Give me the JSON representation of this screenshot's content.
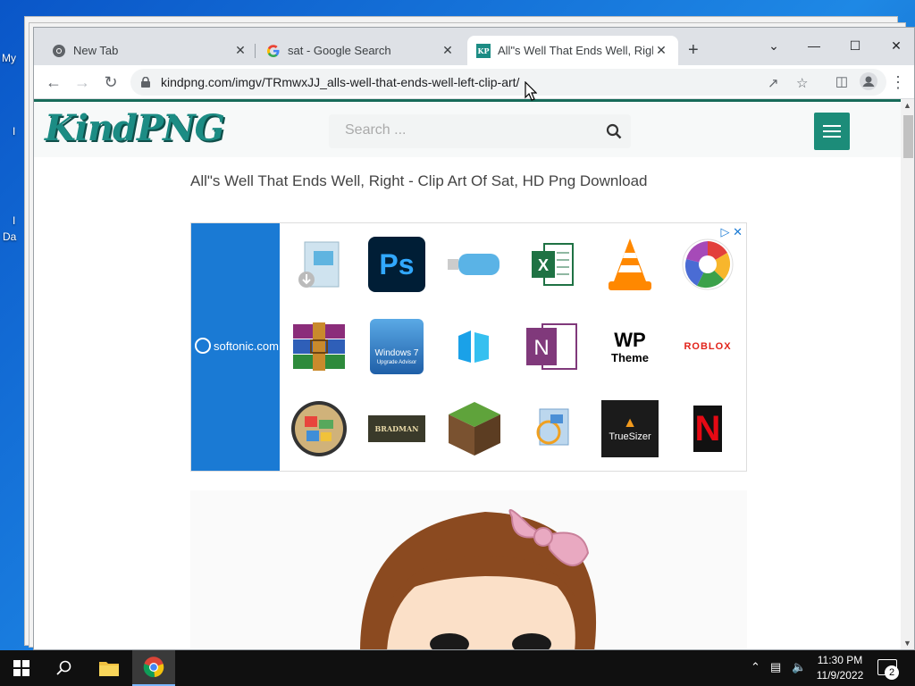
{
  "desktop": {
    "icon_labels": [
      "My",
      "I",
      "Da"
    ]
  },
  "browser": {
    "tabs": [
      {
        "title": "New Tab",
        "favicon": "chrome-icon"
      },
      {
        "title": "sat - Google Search",
        "favicon": "google-icon"
      },
      {
        "title": "All\"s Well That Ends Well, Right",
        "favicon": "kindpng-favicon"
      }
    ],
    "favicon_text": "KP",
    "new_tab": "+",
    "url": "kindpng.com/imgv/TRmwxJJ_alls-well-that-ends-well-left-clip-art/",
    "window_controls": {
      "tab_search": "⌄",
      "minimize": "—",
      "maximize": "☐",
      "close": "✕"
    }
  },
  "site": {
    "logo": "KindPNG",
    "search_placeholder": "Search ...",
    "page_title": "All\"s Well That Ends Well, Right - Clip Art Of Sat, HD Png Download"
  },
  "ad": {
    "brand": "softonic.com",
    "apps": [
      {
        "name": "download-icon"
      },
      {
        "name": "photoshop-icon",
        "label": "Ps"
      },
      {
        "name": "usb-drive-icon"
      },
      {
        "name": "excel-icon"
      },
      {
        "name": "vlc-icon"
      },
      {
        "name": "picasa-icon"
      },
      {
        "name": "winrar-icon"
      },
      {
        "name": "windows7-upgrade-icon",
        "label": "Windows 7",
        "sublabel": "Upgrade Advisor"
      },
      {
        "name": "app-icon"
      },
      {
        "name": "onenote-icon",
        "label": "N"
      },
      {
        "name": "wp-theme-icon",
        "label": "WP",
        "sublabel": "Theme"
      },
      {
        "name": "roblox-icon",
        "label": "ROBLOX"
      },
      {
        "name": "gta-icon"
      },
      {
        "name": "bradman-cricket-icon",
        "label": "BRADMAN"
      },
      {
        "name": "minecraft-icon"
      },
      {
        "name": "app-icon"
      },
      {
        "name": "truesizer-icon",
        "label": "TrueSizer"
      },
      {
        "name": "netflix-icon",
        "label": "N"
      }
    ]
  },
  "taskbar": {
    "time": "11:30 PM",
    "date": "11/9/2022",
    "notification_count": "2"
  },
  "colors": {
    "brand_teal": "#1c8c84",
    "softonic_blue": "#1a7ad4"
  }
}
